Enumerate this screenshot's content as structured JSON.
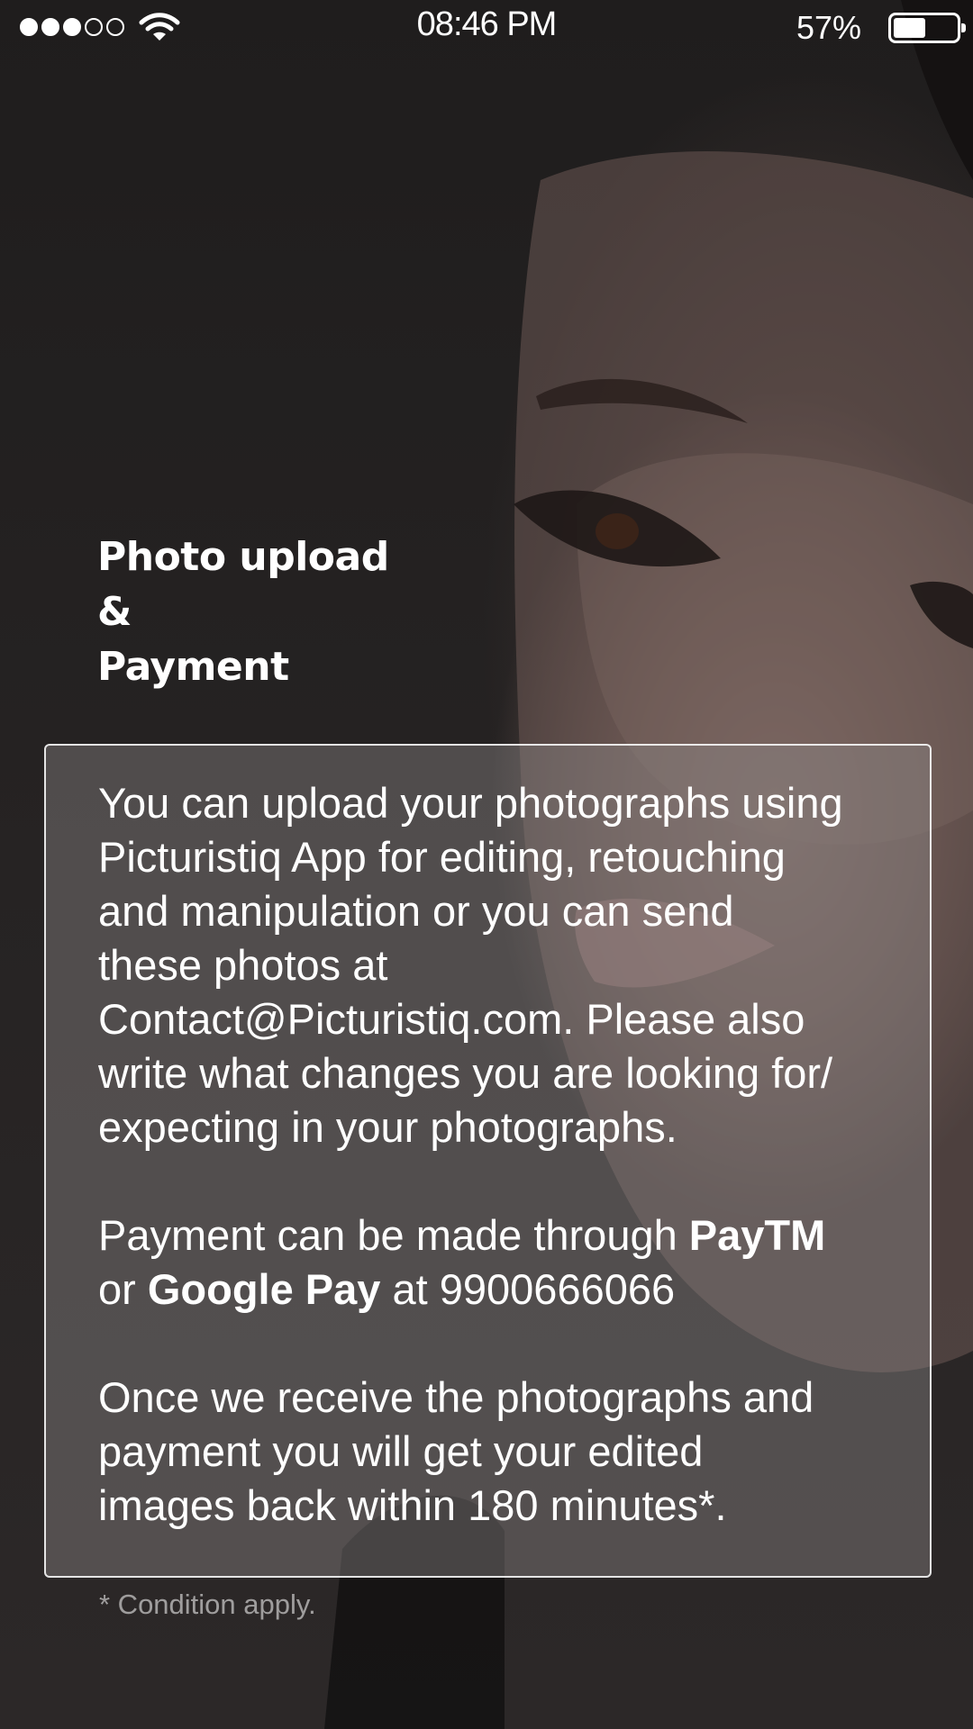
{
  "status_bar": {
    "signal_bars": 5,
    "signal_active": 3,
    "time": "08:46 PM",
    "battery_percent_label": "57%",
    "battery_level": 0.57
  },
  "title": {
    "line1": "Photo upload",
    "line2": "&",
    "line3": "Payment"
  },
  "info": {
    "upload_line1": "You can upload your photographs using",
    "upload_line2": "Picturistiq App for editing, retouching",
    "upload_line3": "and manipulation or you can send",
    "upload_line4": "these photos at",
    "upload_line5": "Contact@Picturistiq.com. Please also",
    "upload_line6": "write what changes you are looking for/",
    "upload_line7": "expecting in your photographs.",
    "payment_prefix": "Payment can be made through ",
    "payment_paytm": "PayTM",
    "payment_or": "or ",
    "payment_gpay": "Google Pay",
    "payment_suffix": " at 9900666066",
    "delivery_line1": "Once we receive the photographs and",
    "delivery_line2": "payment you will get your edited",
    "delivery_line3": "images back within 180 minutes*."
  },
  "footnote": "* Condition apply.",
  "icons": {
    "wifi": "wifi-icon",
    "battery": "battery-icon",
    "signal": "signal-dots-icon"
  }
}
